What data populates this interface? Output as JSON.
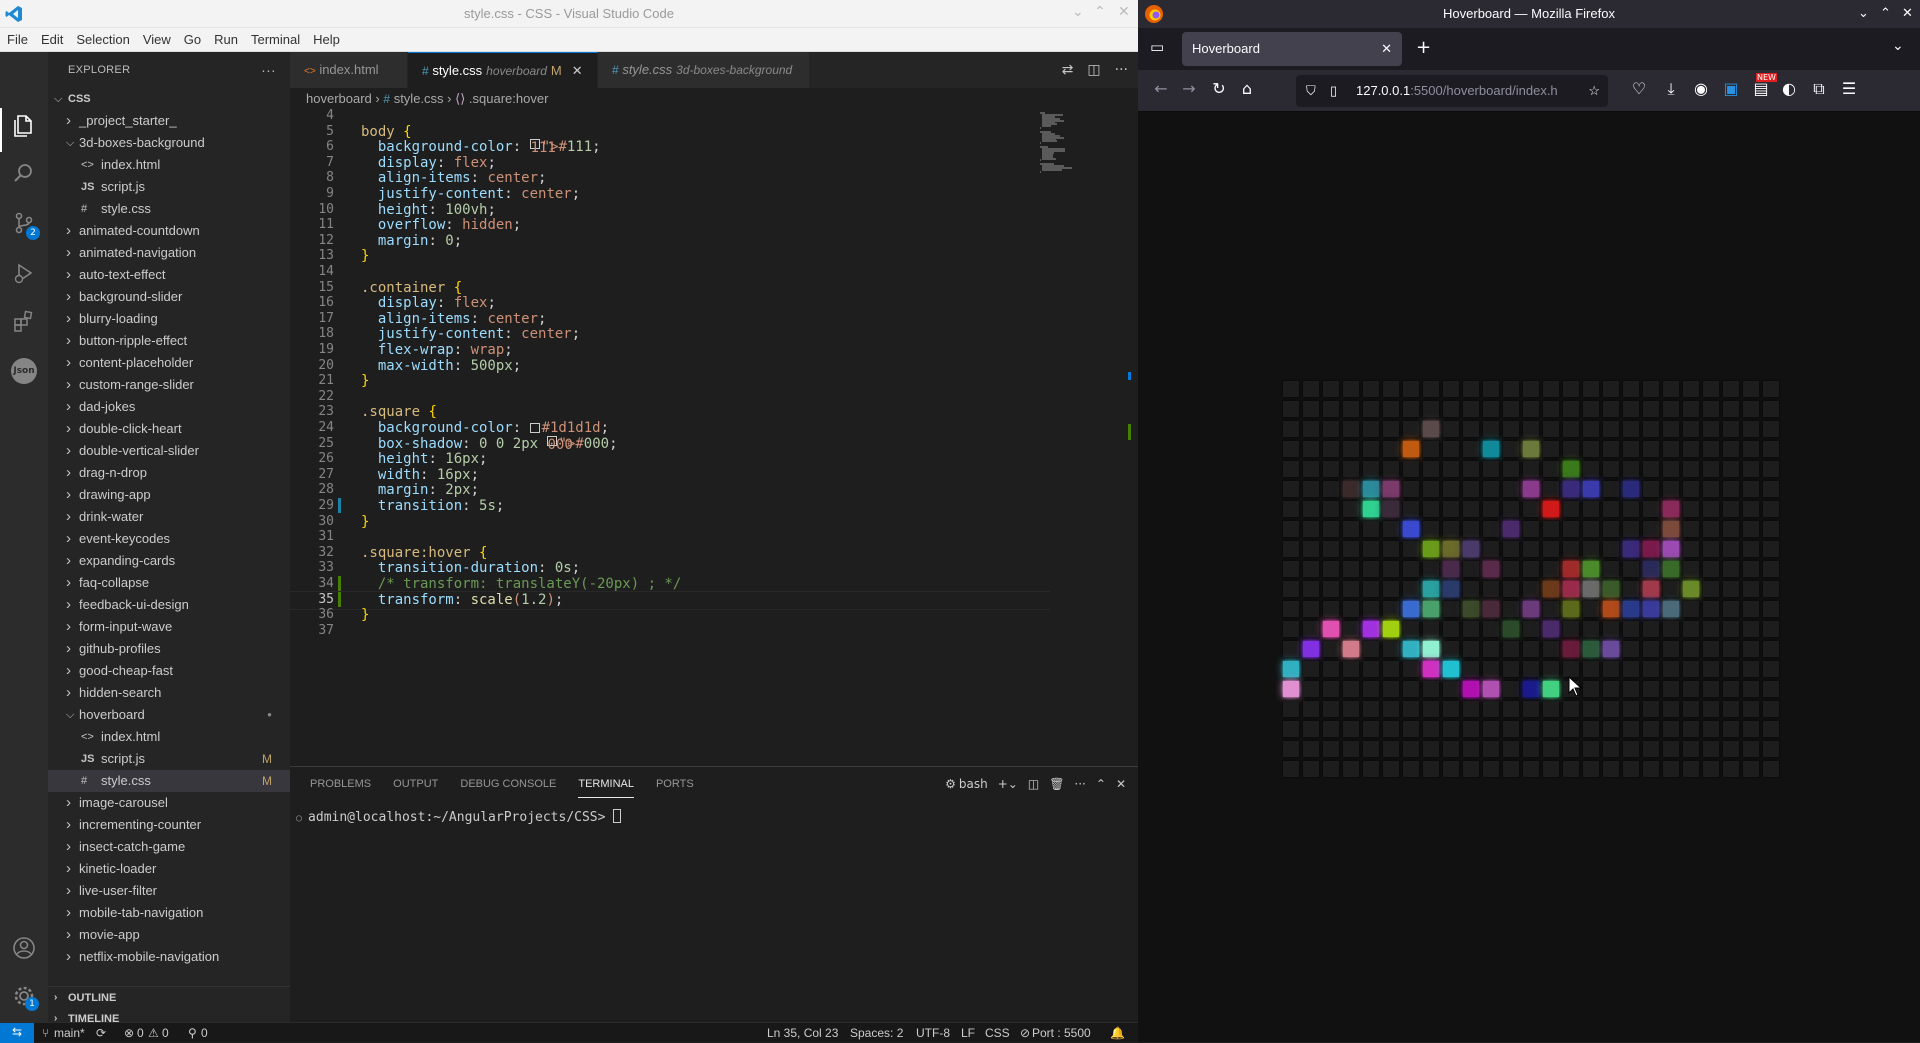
{
  "vscode": {
    "window_title": "style.css - CSS - Visual Studio Code",
    "menu": [
      "File",
      "Edit",
      "Selection",
      "View",
      "Go",
      "Run",
      "Terminal",
      "Help"
    ],
    "activity_icons": [
      "explorer-icon",
      "search-icon",
      "source-control-icon",
      "run-debug-icon",
      "extensions-icon",
      "json-icon",
      "account-icon",
      "settings-gear-icon"
    ],
    "scm_badge": "2",
    "settings_badge": "1",
    "json_label": "Json",
    "explorer": {
      "header": "EXPLORER",
      "root": "CSS",
      "items": [
        {
          "label": "_project_starter_",
          "type": "folder",
          "open": false,
          "depth": 1
        },
        {
          "label": "3d-boxes-background",
          "type": "folder",
          "open": true,
          "depth": 1
        },
        {
          "label": "index.html",
          "type": "html",
          "depth": 2
        },
        {
          "label": "script.js",
          "type": "js",
          "depth": 2
        },
        {
          "label": "style.css",
          "type": "css",
          "depth": 2
        },
        {
          "label": "animated-countdown",
          "type": "folder",
          "open": false,
          "depth": 1
        },
        {
          "label": "animated-navigation",
          "type": "folder",
          "open": false,
          "depth": 1
        },
        {
          "label": "auto-text-effect",
          "type": "folder",
          "open": false,
          "depth": 1
        },
        {
          "label": "background-slider",
          "type": "folder",
          "open": false,
          "depth": 1
        },
        {
          "label": "blurry-loading",
          "type": "folder",
          "open": false,
          "depth": 1
        },
        {
          "label": "button-ripple-effect",
          "type": "folder",
          "open": false,
          "depth": 1
        },
        {
          "label": "content-placeholder",
          "type": "folder",
          "open": false,
          "depth": 1
        },
        {
          "label": "custom-range-slider",
          "type": "folder",
          "open": false,
          "depth": 1
        },
        {
          "label": "dad-jokes",
          "type": "folder",
          "open": false,
          "depth": 1
        },
        {
          "label": "double-click-heart",
          "type": "folder",
          "open": false,
          "depth": 1
        },
        {
          "label": "double-vertical-slider",
          "type": "folder",
          "open": false,
          "depth": 1
        },
        {
          "label": "drag-n-drop",
          "type": "folder",
          "open": false,
          "depth": 1
        },
        {
          "label": "drawing-app",
          "type": "folder",
          "open": false,
          "depth": 1
        },
        {
          "label": "drink-water",
          "type": "folder",
          "open": false,
          "depth": 1
        },
        {
          "label": "event-keycodes",
          "type": "folder",
          "open": false,
          "depth": 1
        },
        {
          "label": "expanding-cards",
          "type": "folder",
          "open": false,
          "depth": 1
        },
        {
          "label": "faq-collapse",
          "type": "folder",
          "open": false,
          "depth": 1
        },
        {
          "label": "feedback-ui-design",
          "type": "folder",
          "open": false,
          "depth": 1
        },
        {
          "label": "form-input-wave",
          "type": "folder",
          "open": false,
          "depth": 1
        },
        {
          "label": "github-profiles",
          "type": "folder",
          "open": false,
          "depth": 1
        },
        {
          "label": "good-cheap-fast",
          "type": "folder",
          "open": false,
          "depth": 1
        },
        {
          "label": "hidden-search",
          "type": "folder",
          "open": false,
          "depth": 1
        },
        {
          "label": "hoverboard",
          "type": "folder",
          "open": true,
          "depth": 1,
          "flag": "●"
        },
        {
          "label": "index.html",
          "type": "html",
          "depth": 2
        },
        {
          "label": "script.js",
          "type": "js",
          "depth": 2,
          "flag": "M"
        },
        {
          "label": "style.css",
          "type": "css",
          "depth": 2,
          "flag": "M",
          "selected": true
        },
        {
          "label": "image-carousel",
          "type": "folder",
          "open": false,
          "depth": 1
        },
        {
          "label": "incrementing-counter",
          "type": "folder",
          "open": false,
          "depth": 1
        },
        {
          "label": "insect-catch-game",
          "type": "folder",
          "open": false,
          "depth": 1
        },
        {
          "label": "kinetic-loader",
          "type": "folder",
          "open": false,
          "depth": 1
        },
        {
          "label": "live-user-filter",
          "type": "folder",
          "open": false,
          "depth": 1
        },
        {
          "label": "mobile-tab-navigation",
          "type": "folder",
          "open": false,
          "depth": 1
        },
        {
          "label": "movie-app",
          "type": "folder",
          "open": false,
          "depth": 1
        },
        {
          "label": "netflix-mobile-navigation",
          "type": "folder",
          "open": false,
          "depth": 1
        }
      ],
      "outline": "OUTLINE",
      "timeline": "TIMELINE"
    },
    "tabs": [
      {
        "label": "index.html",
        "desc": "",
        "icon": "html",
        "active": false
      },
      {
        "label": "style.css",
        "desc": "hoverboard",
        "icon": "css",
        "active": true,
        "modified": "M"
      },
      {
        "label": "style.css",
        "desc": "3d-boxes-background",
        "icon": "css",
        "active": false
      }
    ],
    "breadcrumb": [
      "hoverboard",
      "style.css",
      ".square:hover"
    ],
    "code_lines": [
      {
        "n": "4",
        "t": ""
      },
      {
        "n": "5",
        "t": "body {"
      },
      {
        "n": "6",
        "t": "  background-color: #111;"
      },
      {
        "n": "7",
        "t": "  display: flex;"
      },
      {
        "n": "8",
        "t": "  align-items: center;"
      },
      {
        "n": "9",
        "t": "  justify-content: center;"
      },
      {
        "n": "10",
        "t": "  height: 100vh;"
      },
      {
        "n": "11",
        "t": "  overflow: hidden;"
      },
      {
        "n": "12",
        "t": "  margin: 0;"
      },
      {
        "n": "13",
        "t": "}"
      },
      {
        "n": "14",
        "t": ""
      },
      {
        "n": "15",
        "t": ".container {"
      },
      {
        "n": "16",
        "t": "  display: flex;"
      },
      {
        "n": "17",
        "t": "  align-items: center;"
      },
      {
        "n": "18",
        "t": "  justify-content: center;"
      },
      {
        "n": "19",
        "t": "  flex-wrap: wrap;"
      },
      {
        "n": "20",
        "t": "  max-width: 500px;"
      },
      {
        "n": "21",
        "t": "}"
      },
      {
        "n": "22",
        "t": ""
      },
      {
        "n": "23",
        "t": ".square {"
      },
      {
        "n": "24",
        "t": "  background-color: #1d1d1d;"
      },
      {
        "n": "25",
        "t": "  box-shadow: 0 0 2px #000;"
      },
      {
        "n": "26",
        "t": "  height: 16px;"
      },
      {
        "n": "27",
        "t": "  width: 16px;"
      },
      {
        "n": "28",
        "t": "  margin: 2px;"
      },
      {
        "n": "29",
        "t": "  transition: 5s;"
      },
      {
        "n": "30",
        "t": "}"
      },
      {
        "n": "31",
        "t": ""
      },
      {
        "n": "32",
        "t": ".square:hover {"
      },
      {
        "n": "33",
        "t": "  transition-duration: 0s;"
      },
      {
        "n": "34",
        "t": "  /* transform: translateY(-20px) ; */"
      },
      {
        "n": "35",
        "t": "  transform: scale(1.2);",
        "current": true
      },
      {
        "n": "36",
        "t": "}"
      },
      {
        "n": "37",
        "t": ""
      }
    ],
    "panel": {
      "tabs": [
        "PROBLEMS",
        "OUTPUT",
        "DEBUG CONSOLE",
        "TERMINAL",
        "PORTS"
      ],
      "active": "TERMINAL",
      "shell": "bash",
      "prompt": "admin@localhost:~/AngularProjects/CSS> "
    },
    "status": {
      "branch": "main*",
      "errors": "0",
      "warnings": "0",
      "ports": "0",
      "position": "Ln 35, Col 23",
      "spaces": "Spaces: 2",
      "encoding": "UTF-8",
      "eol": "LF",
      "language": "CSS",
      "server": "Port : 5500"
    }
  },
  "firefox": {
    "window_title": "Hoverboard — Mozilla Firefox",
    "tab_title": "Hoverboard",
    "url_host": "127.0.0.1",
    "url_path": ":5500/hoverboard/index.h",
    "new_badge": "NEW"
  },
  "hoverboard": {
    "columns": 25,
    "rows": 20,
    "base_color": "#1d1d1d",
    "lit": [
      [
        2,
        7,
        "#5a4a4a"
      ],
      [
        3,
        6,
        "#c05a10"
      ],
      [
        3,
        10,
        "#108a9a"
      ],
      [
        3,
        12,
        "#6a7a3a"
      ],
      [
        4,
        14,
        "#3a7a1a"
      ],
      [
        5,
        5,
        "#7a3a6a"
      ],
      [
        5,
        12,
        "#8a3a8a"
      ],
      [
        5,
        14,
        "#3a2a7a"
      ],
      [
        5,
        15,
        "#3a3aaa"
      ],
      [
        5,
        17,
        "#2a2a7a"
      ],
      [
        5,
        3,
        "#3a2a2a"
      ],
      [
        5,
        4,
        "#2a8a9a"
      ],
      [
        6,
        5,
        "#3a2a3a"
      ],
      [
        6,
        13,
        "#d01a1a"
      ],
      [
        6,
        19,
        "#8a2a5a"
      ],
      [
        6,
        4,
        "#30d090"
      ],
      [
        7,
        6,
        "#3a4ad0"
      ],
      [
        7,
        11,
        "#4a2a6a"
      ],
      [
        7,
        19,
        "#7a4a3a"
      ],
      [
        8,
        7,
        "#6a9a1a"
      ],
      [
        8,
        8,
        "#6a6a2a"
      ],
      [
        8,
        9,
        "#4a3a6a"
      ],
      [
        8,
        17,
        "#3a2a7a"
      ],
      [
        8,
        18,
        "#7a1a4a"
      ],
      [
        8,
        19,
        "#9a4ab0"
      ],
      [
        9,
        8,
        "#4a2a4a"
      ],
      [
        9,
        10,
        "#5a2a4a"
      ],
      [
        9,
        14,
        "#a02a2a"
      ],
      [
        9,
        15,
        "#4a8a2a"
      ],
      [
        9,
        18,
        "#2a2a5a"
      ],
      [
        9,
        19,
        "#3a6a2a"
      ],
      [
        10,
        7,
        "#2aa0a0"
      ],
      [
        10,
        8,
        "#2a3a6a"
      ],
      [
        10,
        13,
        "#6a3a1a"
      ],
      [
        10,
        14,
        "#9a2a4a"
      ],
      [
        10,
        15,
        "#6a6a6a"
      ],
      [
        10,
        16,
        "#3a5a2a"
      ],
      [
        10,
        18,
        "#a03a4a"
      ],
      [
        10,
        20,
        "#6a8a2a"
      ],
      [
        11,
        6,
        "#3a6ad0"
      ],
      [
        11,
        7,
        "#4aa06a"
      ],
      [
        11,
        9,
        "#3a4a2a"
      ],
      [
        11,
        10,
        "#4a2a3a"
      ],
      [
        11,
        12,
        "#6a3a7a"
      ],
      [
        11,
        14,
        "#5a6a1a"
      ],
      [
        11,
        16,
        "#b04a1a"
      ],
      [
        11,
        17,
        "#2a3a8a"
      ],
      [
        11,
        18,
        "#3a3a9a"
      ],
      [
        11,
        19,
        "#4a6a7a"
      ],
      [
        12,
        2,
        "#e050b0"
      ],
      [
        12,
        4,
        "#a030e0"
      ],
      [
        12,
        5,
        "#a0d010"
      ],
      [
        12,
        11,
        "#2a4a2a"
      ],
      [
        12,
        13,
        "#4a2a6a"
      ],
      [
        13,
        1,
        "#8030e0"
      ],
      [
        13,
        3,
        "#d07a8a"
      ],
      [
        13,
        6,
        "#30b0c0"
      ],
      [
        13,
        7,
        "#90f0d0"
      ],
      [
        13,
        14,
        "#6a1a3a"
      ],
      [
        13,
        15,
        "#2a5a3a"
      ],
      [
        13,
        16,
        "#6a4a9a"
      ],
      [
        14,
        0,
        "#30b0c0"
      ],
      [
        14,
        7,
        "#d030c0"
      ],
      [
        14,
        8,
        "#20c0d0"
      ],
      [
        15,
        0,
        "#e090d0"
      ],
      [
        15,
        9,
        "#b010b0"
      ],
      [
        15,
        10,
        "#b050b0"
      ],
      [
        15,
        12,
        "#1a1a8a"
      ],
      [
        15,
        13,
        "#40d080"
      ]
    ]
  }
}
